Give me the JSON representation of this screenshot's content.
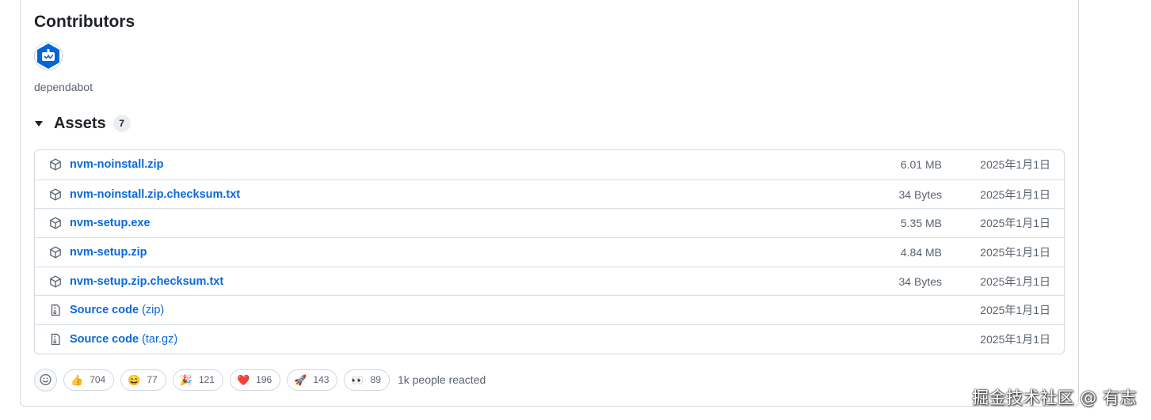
{
  "contributors": {
    "title": "Contributors",
    "items": [
      {
        "name": "dependabot",
        "avatar_icon": "dependabot-icon",
        "avatar_color": "#0366d6"
      }
    ]
  },
  "assets": {
    "title": "Assets",
    "count": "7",
    "items": [
      {
        "icon": "package-icon",
        "name": "nvm-noinstall.zip",
        "suffix": "",
        "size": "6.01 MB",
        "date": "2025年1月1日"
      },
      {
        "icon": "package-icon",
        "name": "nvm-noinstall.zip.checksum.txt",
        "suffix": "",
        "size": "34 Bytes",
        "date": "2025年1月1日"
      },
      {
        "icon": "package-icon",
        "name": "nvm-setup.exe",
        "suffix": "",
        "size": "5.35 MB",
        "date": "2025年1月1日"
      },
      {
        "icon": "package-icon",
        "name": "nvm-setup.zip",
        "suffix": "",
        "size": "4.84 MB",
        "date": "2025年1月1日"
      },
      {
        "icon": "package-icon",
        "name": "nvm-setup.zip.checksum.txt",
        "suffix": "",
        "size": "34 Bytes",
        "date": "2025年1月1日"
      },
      {
        "icon": "file-zip-icon",
        "name": "Source code",
        "suffix": "(zip)",
        "size": "",
        "date": "2025年1月1日"
      },
      {
        "icon": "file-zip-icon",
        "name": "Source code",
        "suffix": "(tar.gz)",
        "size": "",
        "date": "2025年1月1日"
      }
    ]
  },
  "reactions": {
    "items": [
      {
        "emoji": "👍",
        "name": "thumbs-up",
        "count": "704"
      },
      {
        "emoji": "😄",
        "name": "laugh",
        "count": "77"
      },
      {
        "emoji": "🎉",
        "name": "hooray",
        "count": "121"
      },
      {
        "emoji": "❤️",
        "name": "heart",
        "count": "196"
      },
      {
        "emoji": "🚀",
        "name": "rocket",
        "count": "143"
      },
      {
        "emoji": "👀",
        "name": "eyes",
        "count": "89"
      }
    ],
    "summary": "1k people reacted"
  },
  "watermark": "掘金技术社区 @ 有志",
  "colors": {
    "link": "#0969da",
    "muted": "#59636e",
    "border": "#d0d7de"
  }
}
